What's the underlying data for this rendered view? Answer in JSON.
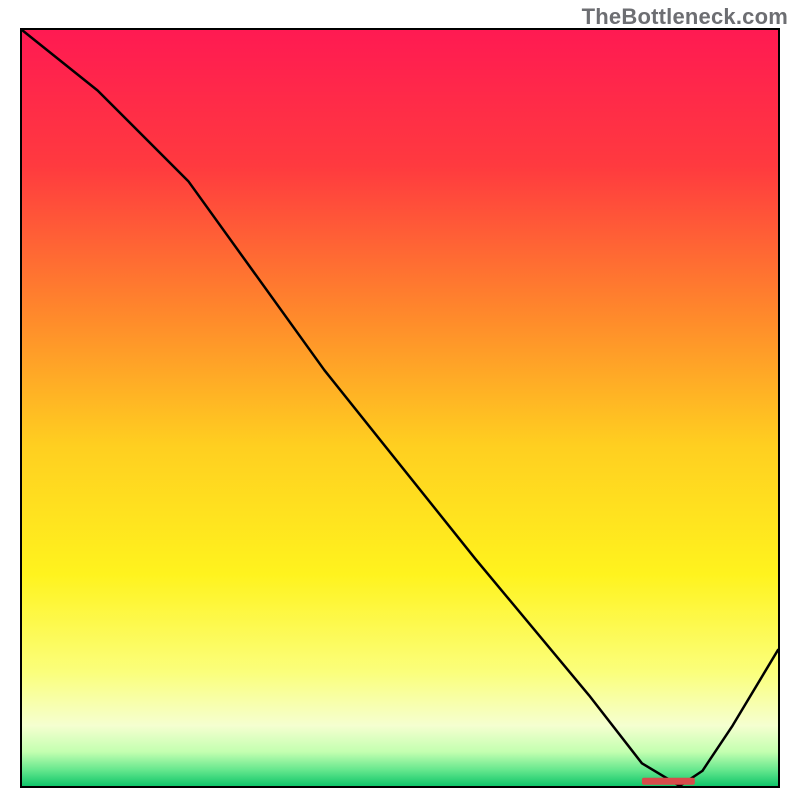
{
  "attribution": "TheBottleneck.com",
  "chart_data": {
    "type": "line",
    "title": "",
    "xlabel": "",
    "ylabel": "",
    "xlim": [
      0,
      100
    ],
    "ylim": [
      0,
      100
    ],
    "grid": false,
    "legend": false,
    "series": [
      {
        "name": "bottleneck-curve",
        "color": "#000000",
        "x": [
          0,
          10,
          22,
          40,
          60,
          75,
          82,
          87,
          90,
          94,
          100
        ],
        "y": [
          100,
          92,
          80,
          55,
          30,
          12,
          3,
          0,
          2,
          8,
          18
        ]
      }
    ],
    "marker": {
      "label": "",
      "x_start": 82,
      "x_end": 89,
      "y": 0.7,
      "color": "#d84b4b"
    },
    "background_gradient": {
      "stops": [
        {
          "offset": 0.0,
          "color": "#ff1a52"
        },
        {
          "offset": 0.18,
          "color": "#ff3a3f"
        },
        {
          "offset": 0.38,
          "color": "#ff8a2b"
        },
        {
          "offset": 0.55,
          "color": "#ffcf20"
        },
        {
          "offset": 0.72,
          "color": "#fff31e"
        },
        {
          "offset": 0.85,
          "color": "#fbff7c"
        },
        {
          "offset": 0.92,
          "color": "#f5ffd0"
        },
        {
          "offset": 0.955,
          "color": "#c3ffb0"
        },
        {
          "offset": 0.978,
          "color": "#69e88f"
        },
        {
          "offset": 1.0,
          "color": "#10c66a"
        }
      ]
    }
  }
}
